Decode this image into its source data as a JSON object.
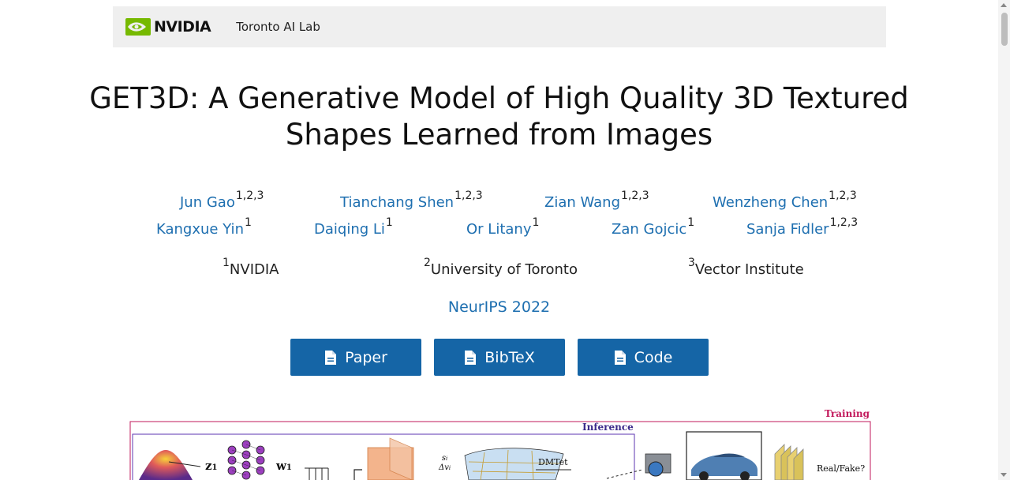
{
  "header": {
    "brand": "NVIDIA",
    "lab": "Toronto AI Lab"
  },
  "title_line1": "GET3D: A Generative Model of High Quality 3D Textured",
  "title_line2": "Shapes Learned from Images",
  "authors_row1": [
    {
      "name": "Jun Gao",
      "sup": "1,2,3"
    },
    {
      "name": "Tianchang Shen",
      "sup": "1,2,3"
    },
    {
      "name": "Zian Wang",
      "sup": "1,2,3"
    },
    {
      "name": "Wenzheng Chen",
      "sup": "1,2,3"
    }
  ],
  "authors_row2": [
    {
      "name": "Kangxue Yin",
      "sup": "1"
    },
    {
      "name": "Daiqing Li",
      "sup": "1"
    },
    {
      "name": "Or Litany",
      "sup": "1"
    },
    {
      "name": "Zan Gojcic",
      "sup": "1"
    },
    {
      "name": "Sanja Fidler",
      "sup": "1,2,3"
    }
  ],
  "affiliations": [
    {
      "sup": "1",
      "name": "NVIDIA"
    },
    {
      "sup": "2",
      "name": "University of Toronto"
    },
    {
      "sup": "3",
      "name": "Vector Institute"
    }
  ],
  "venue": "NeurIPS 2022",
  "buttons": [
    {
      "label": "Paper",
      "icon": "file-icon"
    },
    {
      "label": "BibTeX",
      "icon": "file-icon"
    },
    {
      "label": "Code",
      "icon": "file-icon"
    }
  ],
  "figure": {
    "training_label": "Training",
    "inference_label": "Inference",
    "z_label": "z",
    "z_sub": "1",
    "w_label": "w",
    "w_sub": "1",
    "s_label": "s",
    "s_sub": "i",
    "dv_label": "Δv",
    "dv_sub": "i",
    "dmtet_label": "DMTet",
    "realfake_label": "Real/Fake?"
  },
  "colors": {
    "accent": "#1565a6",
    "link": "#1e6fb0",
    "nvidia_green": "#76b900"
  }
}
